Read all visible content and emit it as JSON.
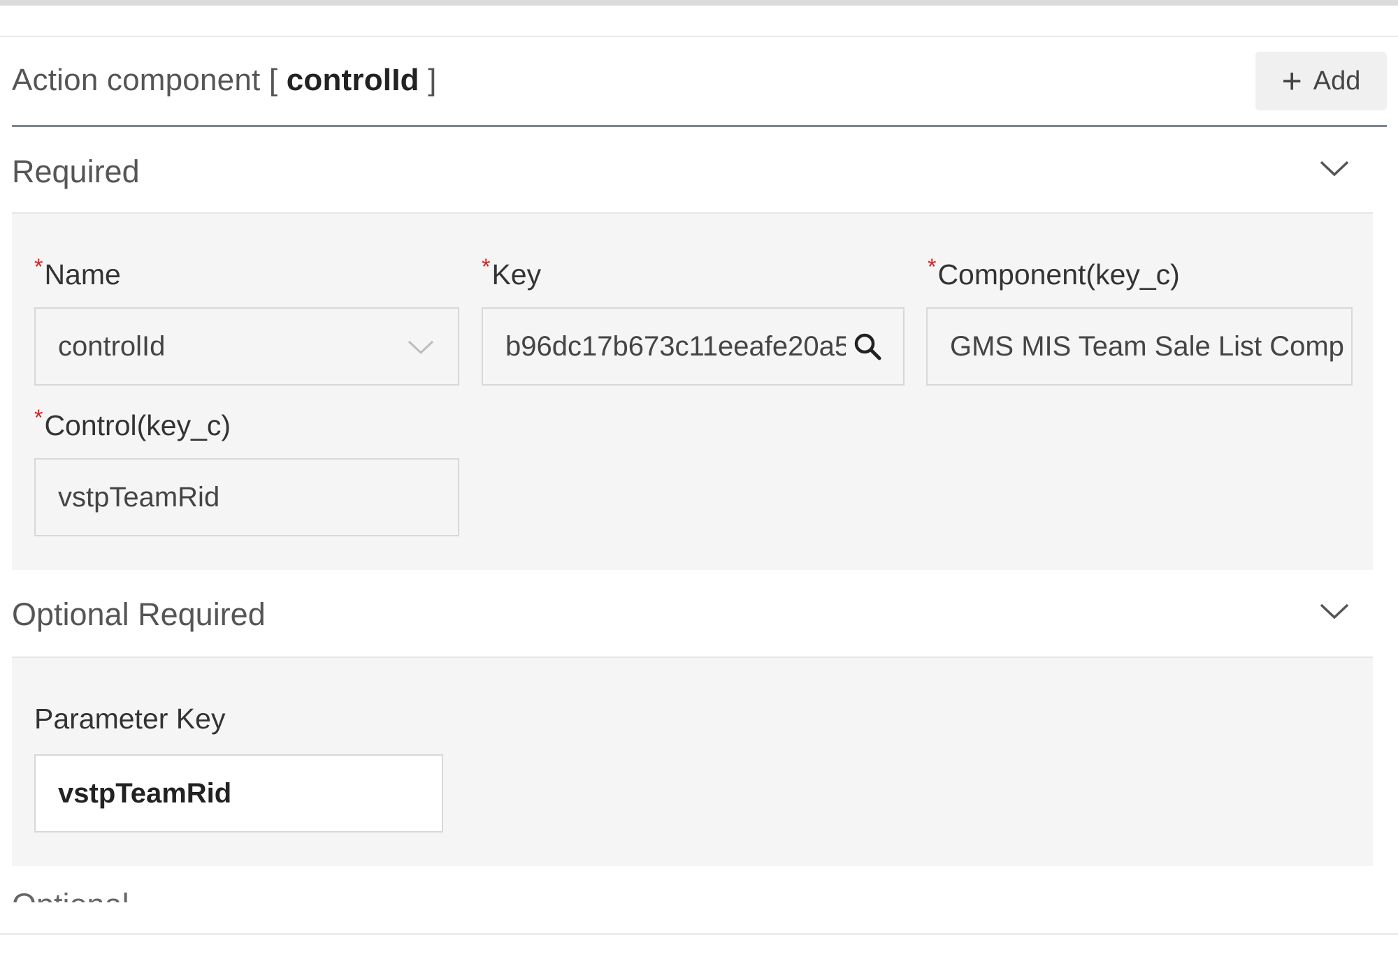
{
  "header": {
    "title_prefix": "Action component [ ",
    "title_value": "controlId",
    "title_suffix": " ]",
    "add_label": "Add"
  },
  "sections": {
    "required": {
      "title": "Required",
      "name_label": "Name",
      "name_value": "controlId",
      "key_label": "Key",
      "key_value": "b96dc17b673c11eeafe20a5",
      "component_label": "Component(key_c)",
      "component_value": "GMS MIS Team Sale List Comp",
      "control_label": "Control(key_c)",
      "control_value": "vstpTeamRid"
    },
    "optional_required": {
      "title": "Optional Required",
      "param_key_label": "Parameter Key",
      "param_key_value": "vstpTeamRid"
    },
    "optional": {
      "title": "Optional"
    }
  },
  "icons": {
    "add": "plus-icon",
    "collapse": "chevron-down-icon",
    "search": "search-icon"
  },
  "colors": {
    "required_marker": "#e02020",
    "header_underline": "#7b8692",
    "section_background": "#f5f5f5"
  }
}
